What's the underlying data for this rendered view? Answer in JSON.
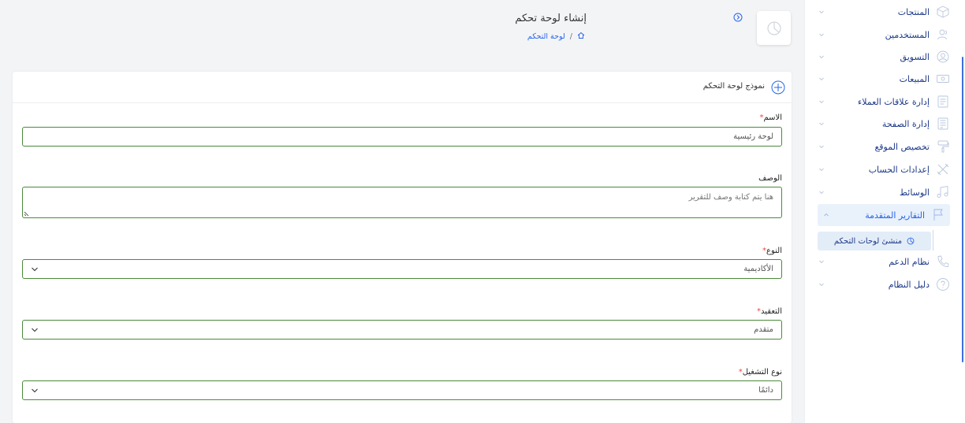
{
  "header": {
    "title": "إنشاء لوحة تحكم",
    "breadcrumb": {
      "separator": "/",
      "current": "لوحة التحكم"
    }
  },
  "card": {
    "title": "نموذج لوحة التحكم"
  },
  "form": {
    "name": {
      "label": "الاسم",
      "required_mark": "*",
      "value": "لوحة رئيسية"
    },
    "description": {
      "label": "الوصف",
      "placeholder": "هنا يتم كتابة وصف للتقرير"
    },
    "type": {
      "label": "النوع",
      "required_mark": "*",
      "selected": "الأكاديمية"
    },
    "complexity": {
      "label": "التعقيد",
      "required_mark": "*",
      "selected": "متقدم"
    },
    "run_type": {
      "label": "نوع التشغيل",
      "required_mark": "*",
      "selected": "دائمًا"
    }
  },
  "sidebar": {
    "items": [
      {
        "label": "المنتجات",
        "icon": "box-icon"
      },
      {
        "label": "المستخدمين",
        "icon": "users-icon"
      },
      {
        "label": "التسويق",
        "icon": "marketing-icon"
      },
      {
        "label": "المبيعات",
        "icon": "sales-icon"
      },
      {
        "label": "إدارة علاقات العملاء",
        "icon": "crm-icon"
      },
      {
        "label": "إدارة الصفحة",
        "icon": "page-icon"
      },
      {
        "label": "تخصيص الموقع",
        "icon": "brush-icon"
      },
      {
        "label": "إعدادات الحساب",
        "icon": "tools-icon"
      },
      {
        "label": "الوسائط",
        "icon": "media-icon"
      },
      {
        "label": "التقارير المتقدمة",
        "icon": "flag-icon"
      },
      {
        "label": "نظام الدعم",
        "icon": "phone-icon"
      },
      {
        "label": "دليل النظام",
        "icon": "help-icon"
      }
    ],
    "sub_item": {
      "label": "منشئ لوحات التحكم",
      "icon": "pie-chart-icon"
    }
  },
  "colors": {
    "accent": "#2563eb",
    "nav_text": "#1e3a8a",
    "input_border": "#4a8a3a",
    "required": "#ef4444",
    "active_bg": "#e9f1fb"
  }
}
